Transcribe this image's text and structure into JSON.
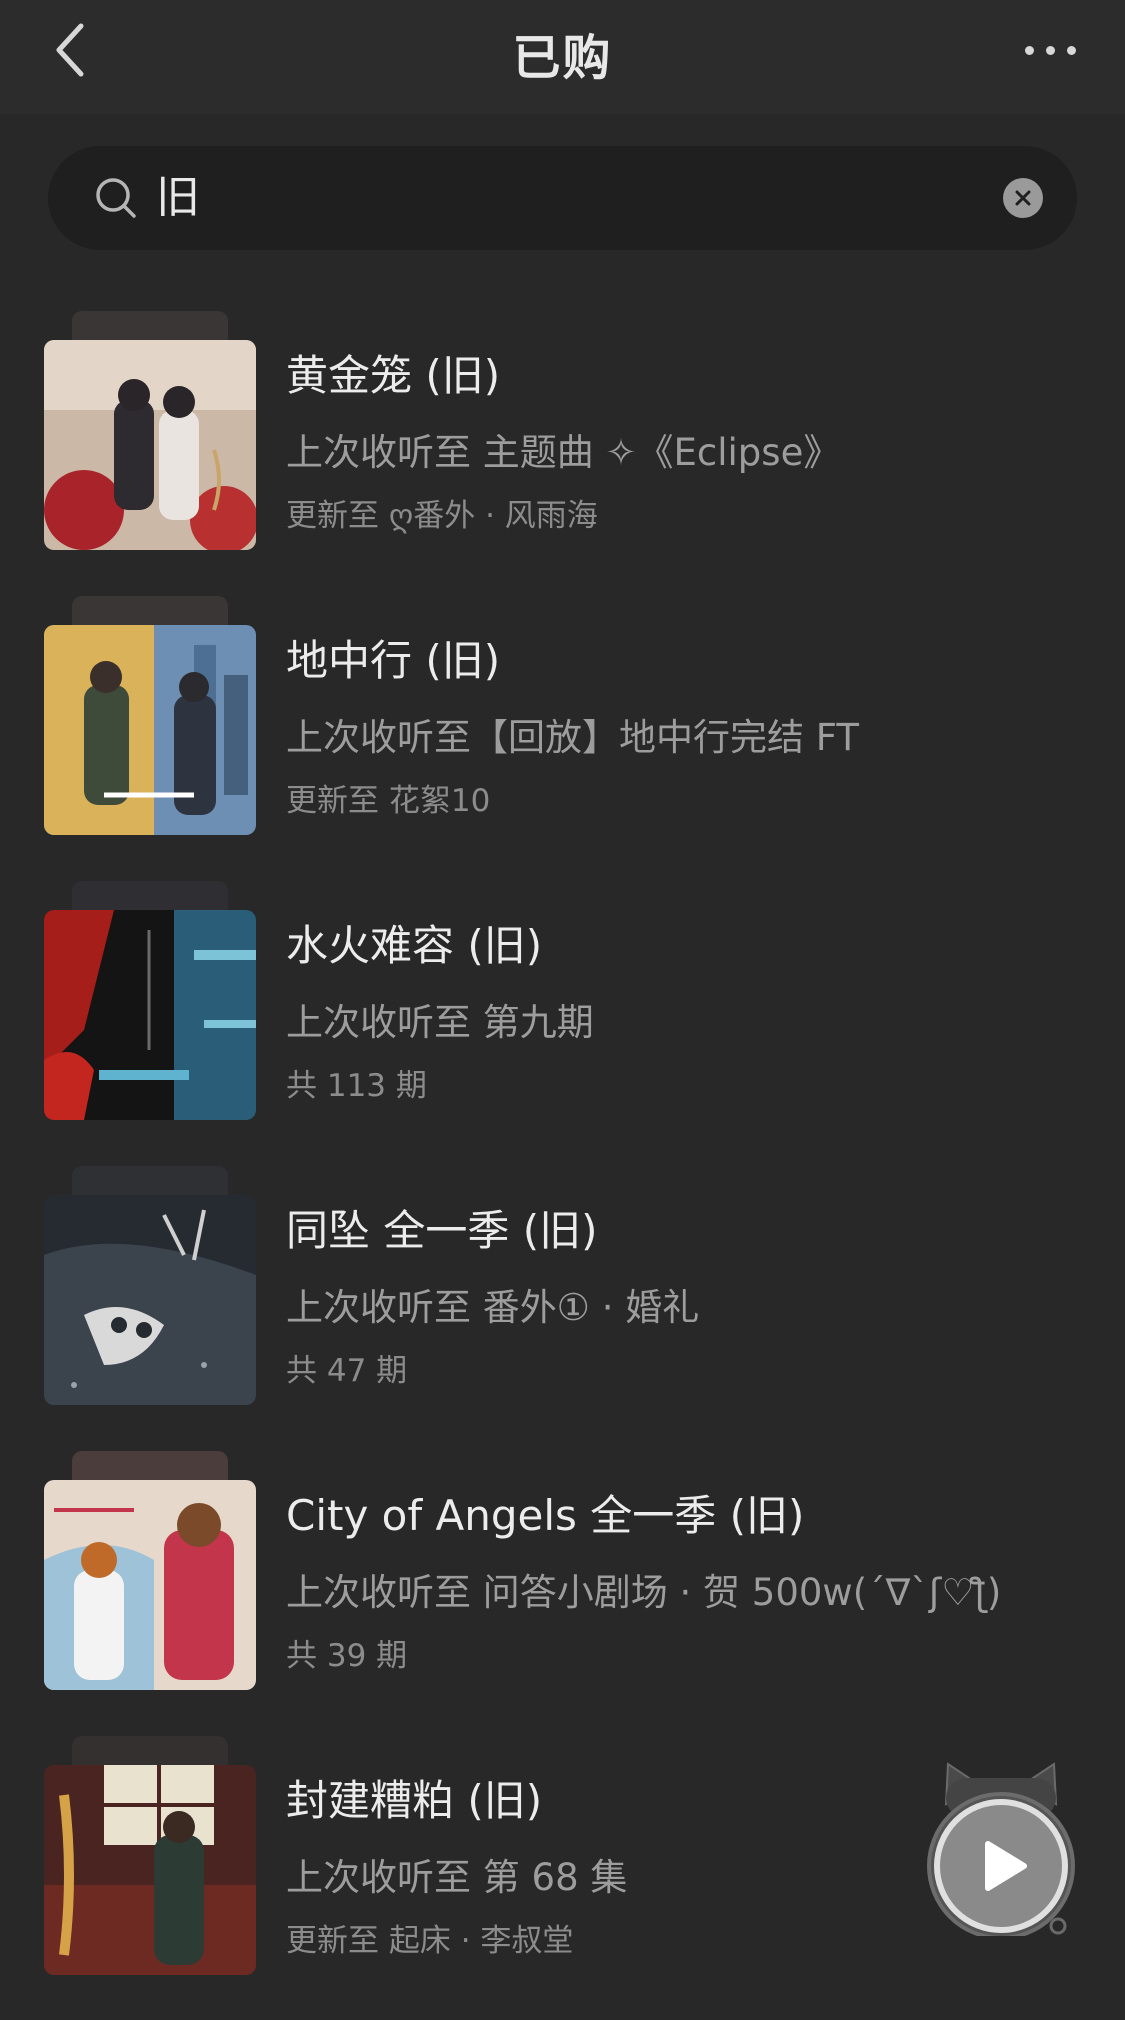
{
  "nav": {
    "title": "已购",
    "back_icon": "chevron-left-icon",
    "more_icon": "more-dots-icon"
  },
  "search": {
    "query": "旧",
    "icon": "search-icon",
    "clear_icon": "clear-circle-icon"
  },
  "items": [
    {
      "title": "黄金笼 (旧)",
      "last_played": "上次收听至 主题曲 ✧《Eclipse》",
      "meta": "更新至 ღ番外 · 风雨海",
      "cover_palette": [
        "#c9b6a4",
        "#a8242a",
        "#2d2a30"
      ]
    },
    {
      "title": "地中行 (旧)",
      "last_played": "上次收听至【回放】地中行完结 FT",
      "meta": "更新至 花絮10",
      "cover_palette": [
        "#d9b25a",
        "#5b7fa6",
        "#2e3340"
      ]
    },
    {
      "title": "水火难容 (旧)",
      "last_played": "上次收听至 第九期",
      "meta": "共 113 期",
      "cover_palette": [
        "#161616",
        "#b3221e",
        "#4a9db5"
      ]
    },
    {
      "title": "同坠 全一季 (旧)",
      "last_played": "上次收听至 番外① · 婚礼",
      "meta": "共 47 期",
      "cover_palette": [
        "#23272d",
        "#6f7781",
        "#cfcfcf"
      ]
    },
    {
      "title": "City of Angels 全一季 (旧)",
      "last_played": "上次收听至 问答小剧场 · 贺 500w(´∇`ʃ♡ƪ)",
      "meta": "共 39 期",
      "cover_palette": [
        "#e7d2c4",
        "#c2354a",
        "#6fa6c9"
      ]
    },
    {
      "title": "封建糟粕 (旧)",
      "last_played": "上次收听至 第 68 集",
      "meta": "更新至 起床 · 李叔堂",
      "cover_palette": [
        "#6d2a23",
        "#d6a247",
        "#2d3b35"
      ]
    }
  ],
  "player": {
    "icon": "play-icon",
    "mascot_icon": "cat-ears-icon"
  }
}
